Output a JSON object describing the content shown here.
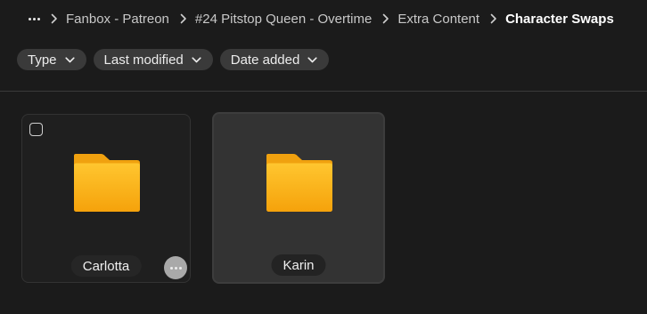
{
  "breadcrumb": {
    "overflow_icon": "more-horizontal-icon",
    "separator_icon": "chevron-right-icon",
    "items": [
      {
        "label": "Fanbox - Patreon"
      },
      {
        "label": "#24 Pitstop Queen - Overtime"
      },
      {
        "label": "Extra Content"
      },
      {
        "label": "Character Swaps"
      }
    ]
  },
  "filters": [
    {
      "label": "Type",
      "icon": "chevron-down-icon"
    },
    {
      "label": "Last modified",
      "icon": "chevron-down-icon"
    },
    {
      "label": "Date added",
      "icon": "chevron-down-icon"
    }
  ],
  "folders": [
    {
      "name": "Carlotta",
      "icon": "folder-icon",
      "selected": false,
      "hovered": false
    },
    {
      "name": "Karin",
      "icon": "folder-icon",
      "selected": false,
      "hovered": true
    }
  ],
  "colors": {
    "background": "#1b1b1b",
    "folder_top": "#ffc02a",
    "folder_bottom": "#f5a30c",
    "pill": "#3a3a3a",
    "current_crumb": "#ffffff"
  }
}
